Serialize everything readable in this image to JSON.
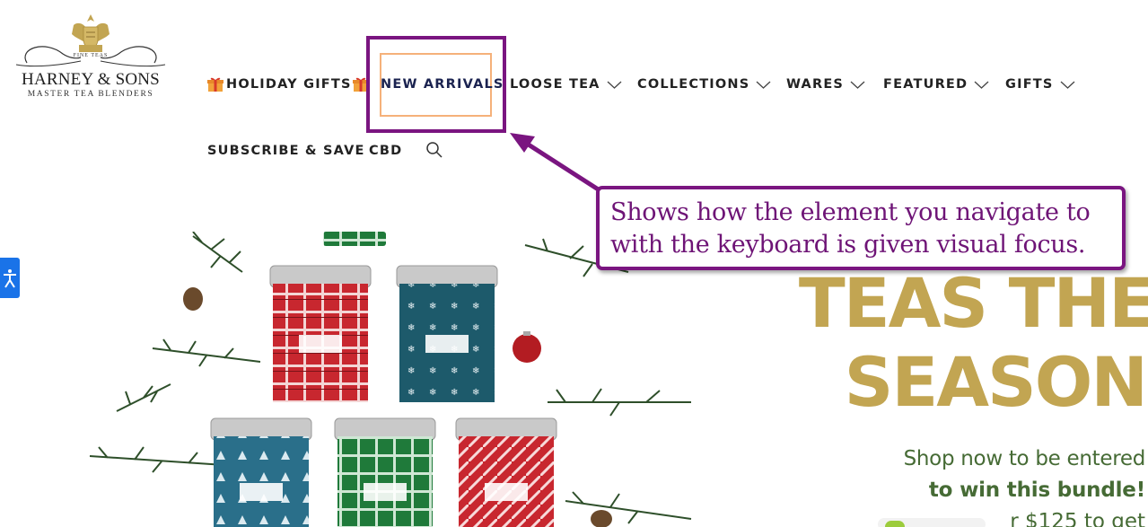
{
  "brand": {
    "name": "HARNEY & SONS",
    "tagline": "MASTER TEA BLENDERS",
    "crest_text": "FINE TEAS"
  },
  "nav": {
    "row1": [
      {
        "label": "HOLIDAY GIFTS",
        "icon": "gift-icon",
        "dropdown": false
      },
      {
        "label": "NEW ARRIVALS",
        "dropdown": false,
        "focused": true
      },
      {
        "label": "LOOSE TEA",
        "dropdown": true
      },
      {
        "label": "COLLECTIONS",
        "dropdown": true
      },
      {
        "label": "WARES",
        "dropdown": true
      },
      {
        "label": "FEATURED",
        "dropdown": true
      },
      {
        "label": "GIFTS",
        "dropdown": true
      }
    ],
    "row2": [
      {
        "label": "SUBSCRIBE & SAVE"
      },
      {
        "label": "CBD"
      }
    ],
    "search_icon": "search-icon"
  },
  "callout": {
    "line1": "Shows how the element you navigate to",
    "line2": "with the keyboard is given visual focus."
  },
  "hero": {
    "title_line1": "TEAS THE",
    "title_line2": "SEASON",
    "subtitle_line1": "Shop now to be entered",
    "subtitle_line2": "to win this bundle!",
    "subtitle_line3_partial": "r $125 to get"
  },
  "colors": {
    "focus_outline": "#7a1580",
    "focus_inner": "#f5b17a",
    "title_gold": "#c2a552",
    "subtitle_green": "#466b35",
    "a11y_blue": "#1a73e8"
  }
}
